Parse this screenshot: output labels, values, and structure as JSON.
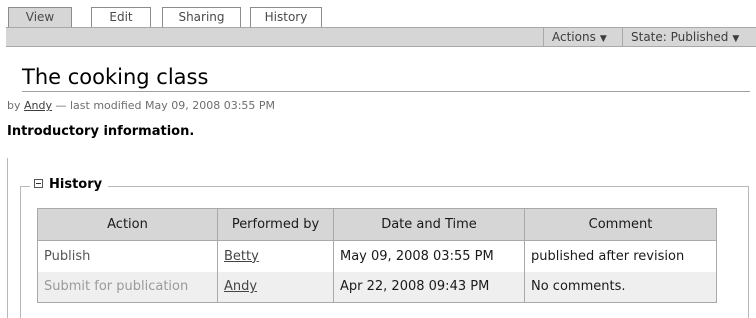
{
  "tabs": [
    {
      "label": "View",
      "selected": true
    },
    {
      "label": "Edit",
      "selected": false
    },
    {
      "label": "Sharing",
      "selected": false
    },
    {
      "label": "History",
      "selected": false
    }
  ],
  "actionbar": {
    "actions_label": "Actions",
    "state_label": "State: Published"
  },
  "document": {
    "title": "The cooking class",
    "byline_prefix": "by ",
    "author": "Andy",
    "byline_suffix": " — last modified May 09, 2008 03:55 PM",
    "intro": "Introductory information."
  },
  "history": {
    "legend": "History",
    "columns": [
      "Action",
      "Performed by",
      "Date and Time",
      "Comment"
    ],
    "rows": [
      {
        "action": "Publish",
        "performed_by": "Betty",
        "date_time": "May 09, 2008 03:55 PM",
        "comment": "published after revision"
      },
      {
        "action": "Submit for publication",
        "performed_by": "Andy",
        "date_time": "Apr 22, 2008 09:43 PM",
        "comment": "No comments."
      }
    ]
  },
  "colors": {
    "bar_gray": "#d6d6d6",
    "row_alt": "#efefef",
    "border": "#a9a9a9"
  }
}
